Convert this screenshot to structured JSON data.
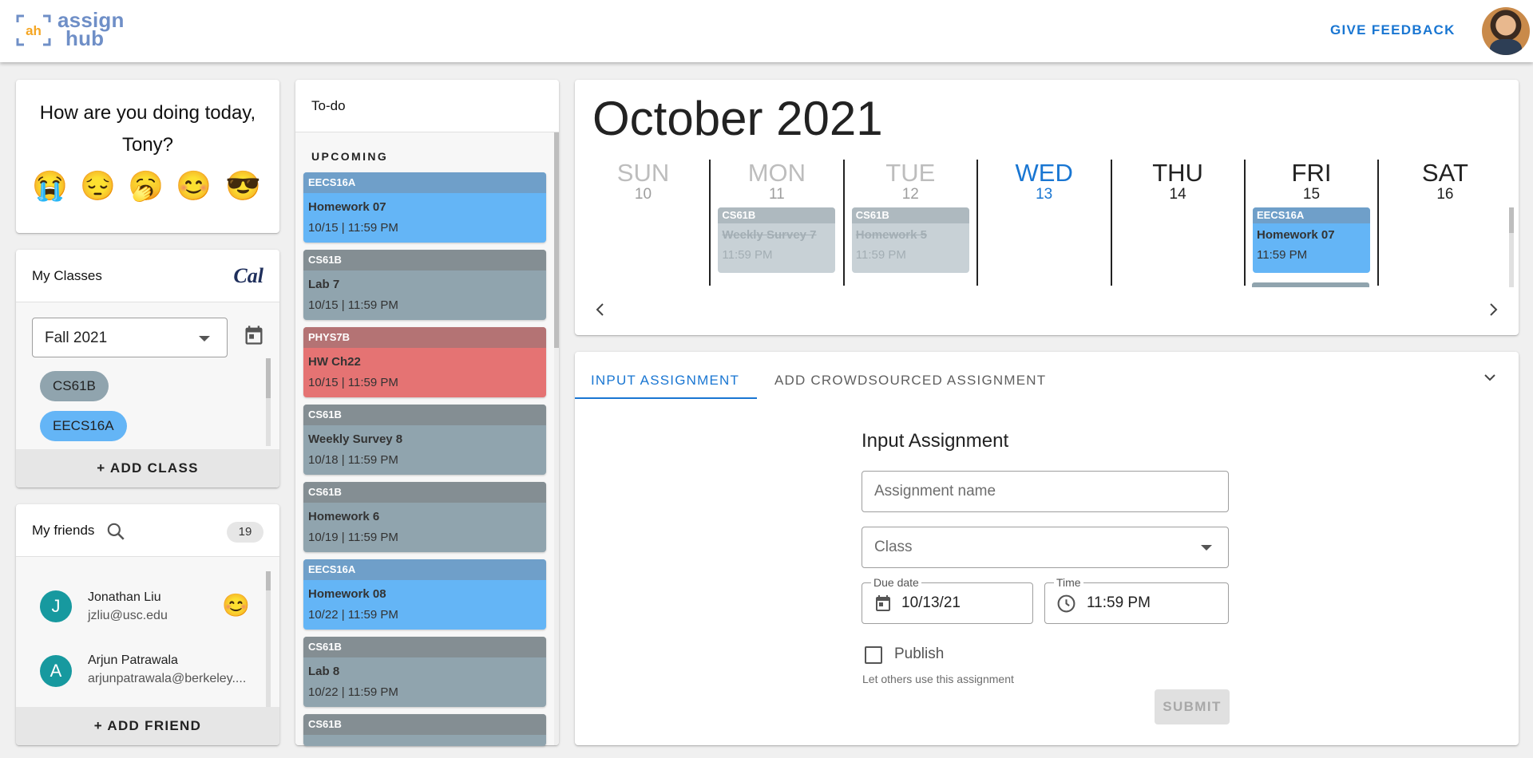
{
  "header": {
    "logo_mark": "ah",
    "logo_line1": "assign",
    "logo_line2": "hub",
    "feedback_label": "GIVE FEEDBACK"
  },
  "mood": {
    "question": "How are you doing today, Tony?",
    "emojis": [
      "😭",
      "😔",
      "🥱",
      "😊",
      "😎"
    ]
  },
  "classes": {
    "title": "My Classes",
    "cal_logo": "Cal",
    "term": "Fall 2021",
    "chips": [
      {
        "label": "CS61B",
        "color": "#90a4ae"
      },
      {
        "label": "EECS16A",
        "color": "#64b5f6"
      }
    ],
    "add_label": "+ ADD CLASS"
  },
  "friends": {
    "title": "My friends",
    "count": "19",
    "list": [
      {
        "initial": "J",
        "name": "Jonathan Liu",
        "email": "jzliu@usc.edu",
        "mood": "😊"
      },
      {
        "initial": "A",
        "name": "Arjun Patrawala",
        "email": "arjunpatrawala@berkeley...."
      }
    ],
    "add_label": "+ ADD FRIEND"
  },
  "todo": {
    "title": "To-do",
    "section": "UPCOMING",
    "tasks": [
      {
        "cls": "EECS16A",
        "name": "Homework 07",
        "date": "10/15 | 11:59 PM",
        "head": "#6f9fc9",
        "body": "#64b5f6"
      },
      {
        "cls": "CS61B",
        "name": "Lab 7",
        "date": "10/15 | 11:59 PM",
        "head": "#848e93",
        "body": "#90a4ae"
      },
      {
        "cls": "PHYS7B",
        "name": "HW Ch22",
        "date": "10/15 | 11:59 PM",
        "head": "#b47374",
        "body": "#e57373"
      },
      {
        "cls": "CS61B",
        "name": "Weekly Survey 8",
        "date": "10/18 | 11:59 PM",
        "head": "#848e93",
        "body": "#90a4ae"
      },
      {
        "cls": "CS61B",
        "name": "Homework 6",
        "date": "10/19 | 11:59 PM",
        "head": "#848e93",
        "body": "#90a4ae"
      },
      {
        "cls": "EECS16A",
        "name": "Homework 08",
        "date": "10/22 | 11:59 PM",
        "head": "#6f9fc9",
        "body": "#64b5f6"
      },
      {
        "cls": "CS61B",
        "name": "Lab 8",
        "date": "10/22 | 11:59 PM",
        "head": "#848e93",
        "body": "#90a4ae"
      },
      {
        "cls": "CS61B",
        "name": "",
        "date": "",
        "head": "#848e93",
        "body": "#90a4ae"
      }
    ]
  },
  "calendar": {
    "month": "October 2021",
    "days": [
      {
        "name": "SUN",
        "num": "10",
        "state": "past"
      },
      {
        "name": "MON",
        "num": "11",
        "state": "past"
      },
      {
        "name": "TUE",
        "num": "12",
        "state": "past"
      },
      {
        "name": "WED",
        "num": "13",
        "state": "today"
      },
      {
        "name": "THU",
        "num": "14",
        "state": "future"
      },
      {
        "name": "FRI",
        "num": "15",
        "state": "future"
      },
      {
        "name": "SAT",
        "num": "16",
        "state": "future"
      }
    ],
    "events": [
      {
        "day": 1,
        "cls": "CS61B",
        "name": "Weekly Survey 7",
        "time": "11:59 PM",
        "done": true
      },
      {
        "day": 2,
        "cls": "CS61B",
        "name": "Homework 5",
        "time": "11:59 PM",
        "done": true
      },
      {
        "day": 5,
        "cls": "EECS16A",
        "name": "Homework 07",
        "time": "11:59 PM",
        "done": false
      }
    ]
  },
  "assignment": {
    "tabs": [
      "INPUT ASSIGNMENT",
      "ADD CROWDSOURCED ASSIGNMENT"
    ],
    "form_title": "Input Assignment",
    "name_placeholder": "Assignment name",
    "class_placeholder": "Class",
    "due_label": "Due date",
    "due_value": "10/13/21",
    "time_label": "Time",
    "time_value": "11:59 PM",
    "publish_label": "Publish",
    "helper": "Let others use this assignment",
    "submit_label": "SUBMIT"
  },
  "colors": {
    "accent": "#1976d2",
    "cs61b": "#90a4ae",
    "eecs16a": "#64b5f6",
    "phys7b": "#e57373"
  }
}
